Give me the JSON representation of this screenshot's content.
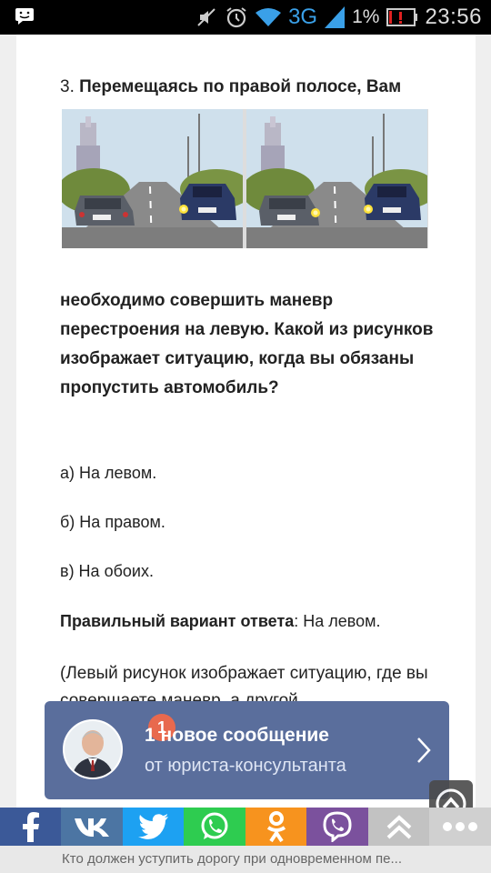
{
  "status_bar": {
    "network": "3G",
    "battery": "1%",
    "time": "23:56"
  },
  "article": {
    "question_number": "3.",
    "question_start": "Перемещаясь по правой полосе, Вам",
    "question_rest": "необходимо совершить маневр перестроения на левую. Какой из рисунков изображает ситуацию, когда вы обязаны пропустить автомобиль?",
    "answers": [
      "а) На левом.",
      "б) На правом.",
      "в) На обоих."
    ],
    "correct_label": "Правильный вариант ответа",
    "correct_value": ": На левом.",
    "explanation": "(Левый рисунок изображает ситуацию, где вы совершаете маневр, а другой"
  },
  "notification": {
    "badge": "1",
    "title": "1 новое сообщение",
    "subtitle": "от юриста-консультанта"
  },
  "share": [
    "facebook-icon",
    "vk-icon",
    "twitter-icon",
    "whatsapp-icon",
    "odnoklassniki-icon",
    "viber-icon",
    "chevrons-up-icon",
    "more-icon"
  ],
  "bottom_text": "Кто должен уступить дорогу при одновременном пе..."
}
